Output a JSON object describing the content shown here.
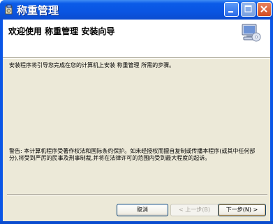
{
  "window": {
    "title": "称重管理"
  },
  "header": {
    "title": "欢迎使用 称重管理 安装向导"
  },
  "body": {
    "intro": "安装程序将引导您完成在您的计算机上安装 称重管理 所需的步骤。",
    "warning": "警告: 本计算机程序受著作权法和国际条约保护。如未经授权而擅自复制或传播本程序(或其中任何部分),将受到严厉的民事及刑事制裁,并将在法律许可的范围内受到最大程度的起诉。"
  },
  "buttons": {
    "cancel": "取消",
    "back": "< 上一步(B)",
    "next": "下一步(N) >"
  },
  "icons": {
    "app": "installer-app-icon",
    "header": "computer-cd-icon"
  },
  "colors": {
    "titlebar": "#0a55e2",
    "client": "#ece9d8",
    "close": "#d24d22"
  }
}
